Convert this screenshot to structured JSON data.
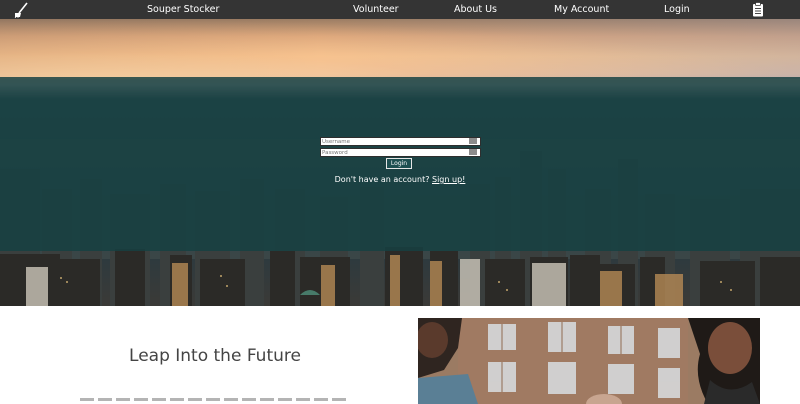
{
  "nav": {
    "brand": "Souper Stocker",
    "links": [
      "Volunteer",
      "About Us",
      "My Account",
      "Login"
    ],
    "logo_icon": "mop-icon",
    "cart_icon": "clipboard-icon",
    "background": "#343434"
  },
  "login": {
    "username_placeholder": "Username",
    "password_placeholder": "Password",
    "submit_label": "Login",
    "signup_prompt": "Don't have an account?",
    "signup_link": "Sign up!",
    "overlay_color": "#164042"
  },
  "content": {
    "title": "Leap Into the Future"
  }
}
